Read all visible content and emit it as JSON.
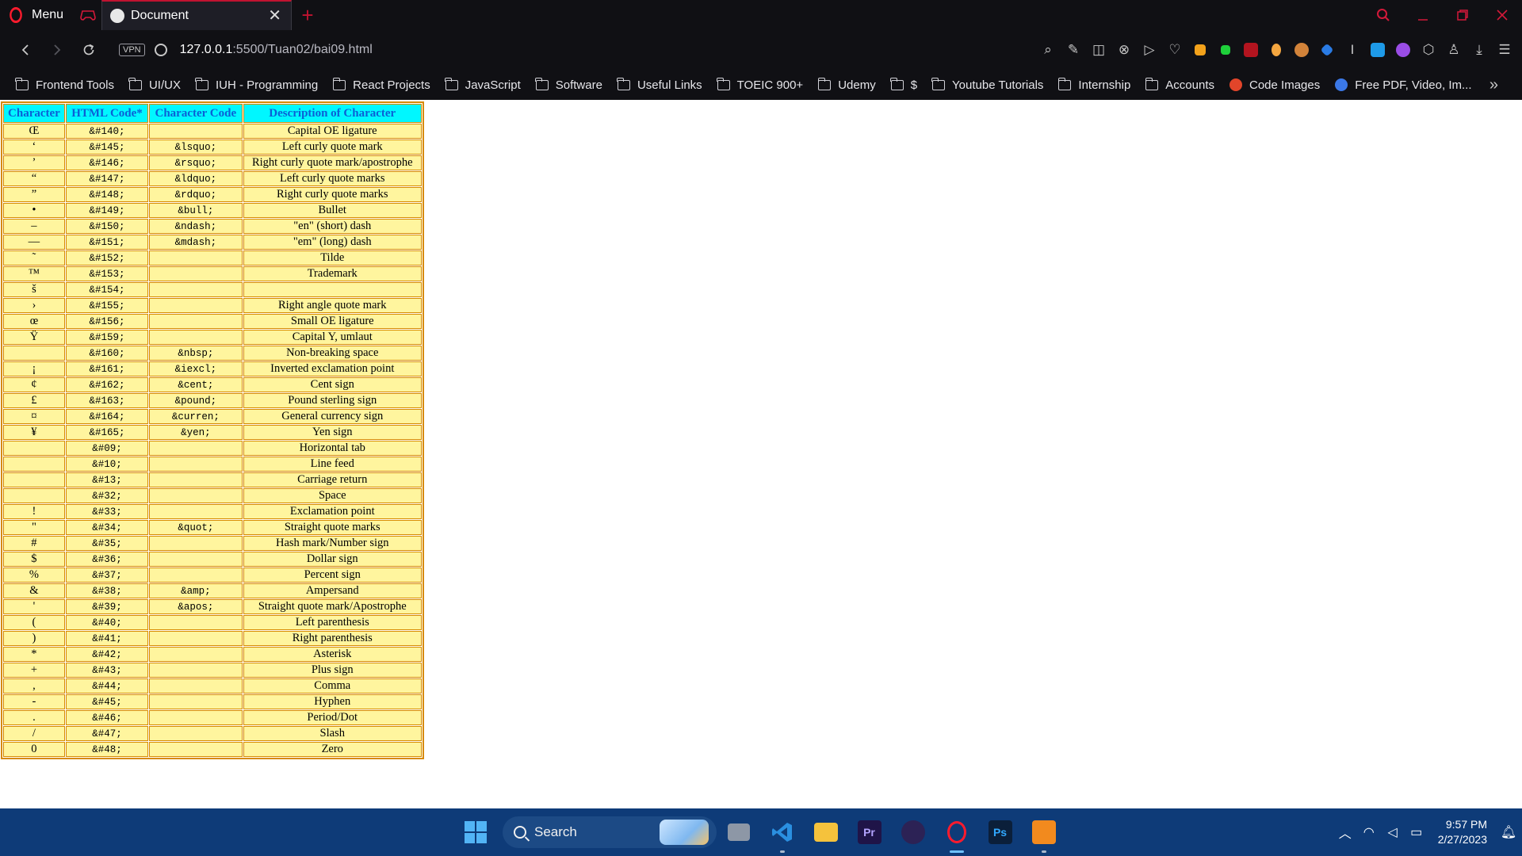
{
  "browser": {
    "menu_label": "Menu",
    "tab_title": "Document",
    "tab_close": "✕",
    "new_tab": "+",
    "url_host": "127.0.0.1",
    "url_path": ":5500/Tuan02/bai09.html",
    "vpn_label": "VPN",
    "more_bookmarks": "»",
    "accent_color": "#ff1b2d"
  },
  "bookmarks": [
    {
      "label": "Frontend Tools",
      "type": "folder"
    },
    {
      "label": "UI/UX",
      "type": "folder"
    },
    {
      "label": "IUH - Programming",
      "type": "folder"
    },
    {
      "label": "React Projects",
      "type": "folder"
    },
    {
      "label": "JavaScript",
      "type": "folder"
    },
    {
      "label": "Software",
      "type": "folder"
    },
    {
      "label": "Useful Links",
      "type": "folder"
    },
    {
      "label": "TOEIC 900+",
      "type": "folder"
    },
    {
      "label": "Udemy",
      "type": "folder"
    },
    {
      "label": "$",
      "type": "folder"
    },
    {
      "label": "Youtube Tutorials",
      "type": "folder"
    },
    {
      "label": "Internship",
      "type": "folder"
    },
    {
      "label": "Accounts",
      "type": "folder"
    },
    {
      "label": "Code Images",
      "type": "link"
    },
    {
      "label": "Free PDF, Video, Im...",
      "type": "link"
    }
  ],
  "table": {
    "headers": [
      "Character",
      "HTML Code*",
      "Character Code",
      "Description of Character"
    ],
    "rows": [
      [
        "Œ",
        "&#140;",
        "",
        "Capital OE ligature"
      ],
      [
        "‘",
        "&#145;",
        "&lsquo;",
        "Left curly quote mark"
      ],
      [
        "’",
        "&#146;",
        "&rsquo;",
        "Right curly quote mark/apostrophe"
      ],
      [
        "“",
        "&#147;",
        "&ldquo;",
        "Left curly quote marks"
      ],
      [
        "”",
        "&#148;",
        "&rdquo;",
        "Right curly quote marks"
      ],
      [
        "•",
        "&#149;",
        "&bull;",
        "Bullet"
      ],
      [
        "–",
        "&#150;",
        "&ndash;",
        "\"en\" (short) dash"
      ],
      [
        "—",
        "&#151;",
        "&mdash;",
        "\"em\" (long) dash"
      ],
      [
        "˜",
        "&#152;",
        "",
        "Tilde"
      ],
      [
        "™",
        "&#153;",
        "",
        "Trademark"
      ],
      [
        "š",
        "&#154;",
        "",
        ""
      ],
      [
        "›",
        "&#155;",
        "",
        "Right angle quote mark"
      ],
      [
        "œ",
        "&#156;",
        "",
        "Small OE ligature"
      ],
      [
        "Ÿ",
        "&#159;",
        "",
        "Capital Y, umlaut"
      ],
      [
        "",
        "&#160;",
        "&nbsp;",
        "Non-breaking space"
      ],
      [
        "¡",
        "&#161;",
        "&iexcl;",
        "Inverted exclamation point"
      ],
      [
        "¢",
        "&#162;",
        "&cent;",
        "Cent sign"
      ],
      [
        "£",
        "&#163;",
        "&pound;",
        "Pound sterling sign"
      ],
      [
        "¤",
        "&#164;",
        "&curren;",
        "General currency sign"
      ],
      [
        "¥",
        "&#165;",
        "&yen;",
        "Yen sign"
      ],
      [
        "",
        "&#09;",
        "",
        "Horizontal tab"
      ],
      [
        "",
        "&#10;",
        "",
        "Line feed"
      ],
      [
        "",
        "&#13;",
        "",
        "Carriage return"
      ],
      [
        "",
        "&#32;",
        "",
        "Space"
      ],
      [
        "!",
        "&#33;",
        "",
        "Exclamation point"
      ],
      [
        "\"",
        "&#34;",
        "&quot;",
        "Straight quote marks"
      ],
      [
        "#",
        "&#35;",
        "",
        "Hash mark/Number sign"
      ],
      [
        "$",
        "&#36;",
        "",
        "Dollar sign"
      ],
      [
        "%",
        "&#37;",
        "",
        "Percent sign"
      ],
      [
        "&",
        "&#38;",
        "&amp;",
        "Ampersand"
      ],
      [
        "'",
        "&#39;",
        "&apos;",
        "Straight quote mark/Apostrophe"
      ],
      [
        "(",
        "&#40;",
        "",
        "Left parenthesis"
      ],
      [
        ")",
        "&#41;",
        "",
        "Right parenthesis"
      ],
      [
        "*",
        "&#42;",
        "",
        "Asterisk"
      ],
      [
        "+",
        "&#43;",
        "",
        "Plus sign"
      ],
      [
        ",",
        "&#44;",
        "",
        "Comma"
      ],
      [
        "-",
        "&#45;",
        "",
        "Hyphen"
      ],
      [
        ".",
        "&#46;",
        "",
        "Period/Dot"
      ],
      [
        "/",
        "&#47;",
        "",
        "Slash"
      ],
      [
        "0",
        "&#48;",
        "",
        "Zero"
      ]
    ],
    "header_bg": "#00f7ff",
    "header_text_color": "#0b5fd6",
    "cell_bg": "#fff59e",
    "border_color": "#d78a00"
  },
  "taskbar": {
    "search_label": "Search",
    "apps": [
      {
        "name": "task-view",
        "label": ""
      },
      {
        "name": "vscode",
        "label": ""
      },
      {
        "name": "file-explorer",
        "label": ""
      },
      {
        "name": "premiere-pro",
        "label": "Pr"
      },
      {
        "name": "eclipse",
        "label": ""
      },
      {
        "name": "opera",
        "label": ""
      },
      {
        "name": "photoshop",
        "label": "Ps"
      },
      {
        "name": "pdf-app",
        "label": ""
      }
    ],
    "time": "9:57 PM",
    "date": "2/27/2023"
  }
}
